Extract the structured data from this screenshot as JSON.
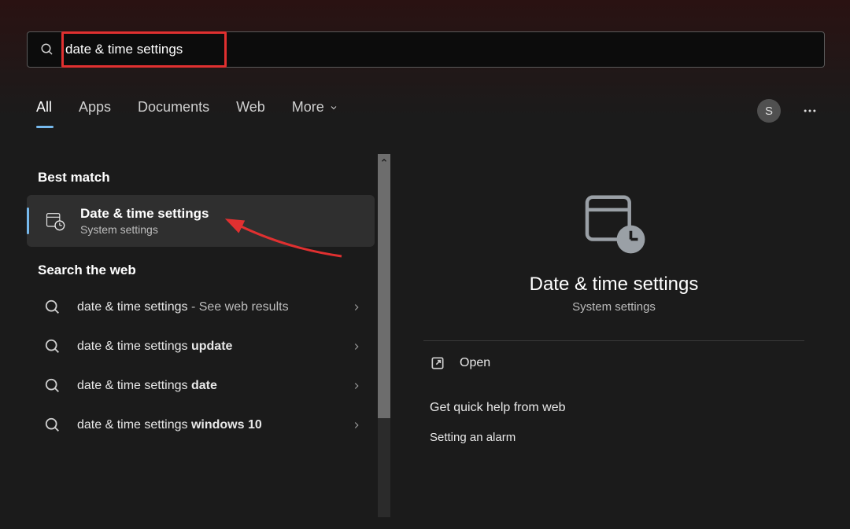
{
  "search": {
    "value": "date & time settings"
  },
  "tabs": {
    "all": "All",
    "apps": "Apps",
    "documents": "Documents",
    "web": "Web",
    "more": "More"
  },
  "avatar_initial": "S",
  "left": {
    "best_match_label": "Best match",
    "best_match": {
      "title": "Date & time settings",
      "subtitle": "System settings"
    },
    "search_web_label": "Search the web",
    "web_items": [
      {
        "prefix": "date & time settings",
        "suffix": "",
        "trail": " - See web results"
      },
      {
        "prefix": "date & time settings ",
        "suffix": "update",
        "trail": ""
      },
      {
        "prefix": "date & time settings ",
        "suffix": "date",
        "trail": ""
      },
      {
        "prefix": "date & time settings ",
        "suffix": "windows 10",
        "trail": ""
      }
    ]
  },
  "preview": {
    "title": "Date & time settings",
    "subtitle": "System settings",
    "open_label": "Open",
    "help_heading": "Get quick help from web",
    "links": [
      "Setting an alarm"
    ]
  }
}
